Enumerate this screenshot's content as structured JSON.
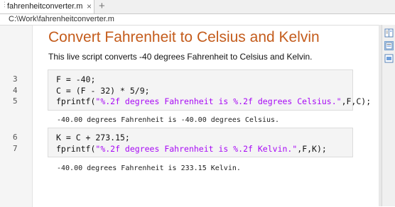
{
  "tab": {
    "label": "fahrenheitconverter.m",
    "close": "×",
    "add": "+"
  },
  "path": "C:\\Work\\fahrenheitconverter.m",
  "document": {
    "title": "Convert Fahrenheit to Celsius and Kelvin",
    "description": "This live script converts -40 degrees Fahrenheit to Celsius and Kelvin."
  },
  "code_sections": [
    {
      "lines": [
        {
          "number": "3",
          "text": "F = -40;"
        },
        {
          "number": "4",
          "text": "C = (F - 32) * 5/9;"
        },
        {
          "number": "5",
          "pre": "fprintf(",
          "string": "\"%.2f degrees Fahrenheit is %.2f degrees Celsius.\"",
          "post": ",F,C);"
        }
      ],
      "output": "-40.00 degrees Fahrenheit is -40.00 degrees Celsius."
    },
    {
      "lines": [
        {
          "number": "6",
          "text": "K = C + 273.15;"
        },
        {
          "number": "7",
          "pre": "fprintf(",
          "string": "\"%.2f degrees Fahrenheit is %.2f Kelvin.\"",
          "post": ",F,K);"
        }
      ],
      "output": "-40.00 degrees Fahrenheit is 233.15 Kelvin."
    }
  ],
  "right_toolstrip": [
    "output-on-right-icon",
    "output-inline-icon",
    "hide-code-icon"
  ],
  "colors": {
    "title": "#c45c1c",
    "string": "#a709f5",
    "code_background": "#f4f4f4"
  }
}
